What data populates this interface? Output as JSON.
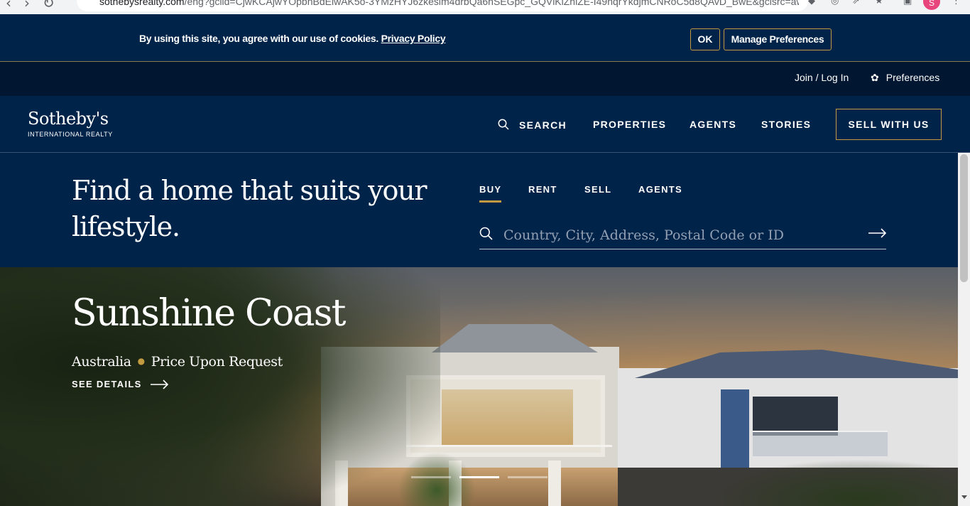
{
  "browser": {
    "url_host": "sothebysrealty.com",
    "url_path": "/eng?gclid=CjwKCAjwYOpbhBdEiwAK5o-3YMzHYJ6zkesim4drbQa6hSEGpc_GQVlKlZhlZE-I49nqrYkdjmCNRoC5d8QAvD_BwE&gclsrc=aw.ds",
    "profile_initial": "S"
  },
  "cookie": {
    "message": "By using this site, you agree with our use of cookies.",
    "privacy_link": "Privacy Policy",
    "ok_label": "OK",
    "manage_label": "Manage Preferences"
  },
  "utility": {
    "join_label": "Join / Log In",
    "preferences_label": "Preferences",
    "preferences_icon": "gear-icon"
  },
  "header": {
    "logo_name": "Sotheby's",
    "logo_sub": "INTERNATIONAL REALTY",
    "nav": {
      "search": "SEARCH",
      "properties": "PROPERTIES",
      "agents": "AGENTS",
      "stories": "STORIES"
    },
    "sell_label": "SELL WITH US"
  },
  "search": {
    "headline": "Find a home that suits your lifestyle.",
    "tabs": [
      "BUY",
      "RENT",
      "SELL",
      "AGENTS"
    ],
    "active_tab": "BUY",
    "placeholder": "Country, City, Address, Postal Code or ID",
    "value": ""
  },
  "hero": {
    "title": "Sunshine Coast",
    "location": "Australia",
    "price": "Price Upon Request",
    "details_label": "SEE DETAILS",
    "slides_count": 3,
    "active_slide": 2
  },
  "colors": {
    "navy": "#002349",
    "dark_navy": "#001631",
    "gold": "#c29b40",
    "white": "#ffffff"
  }
}
